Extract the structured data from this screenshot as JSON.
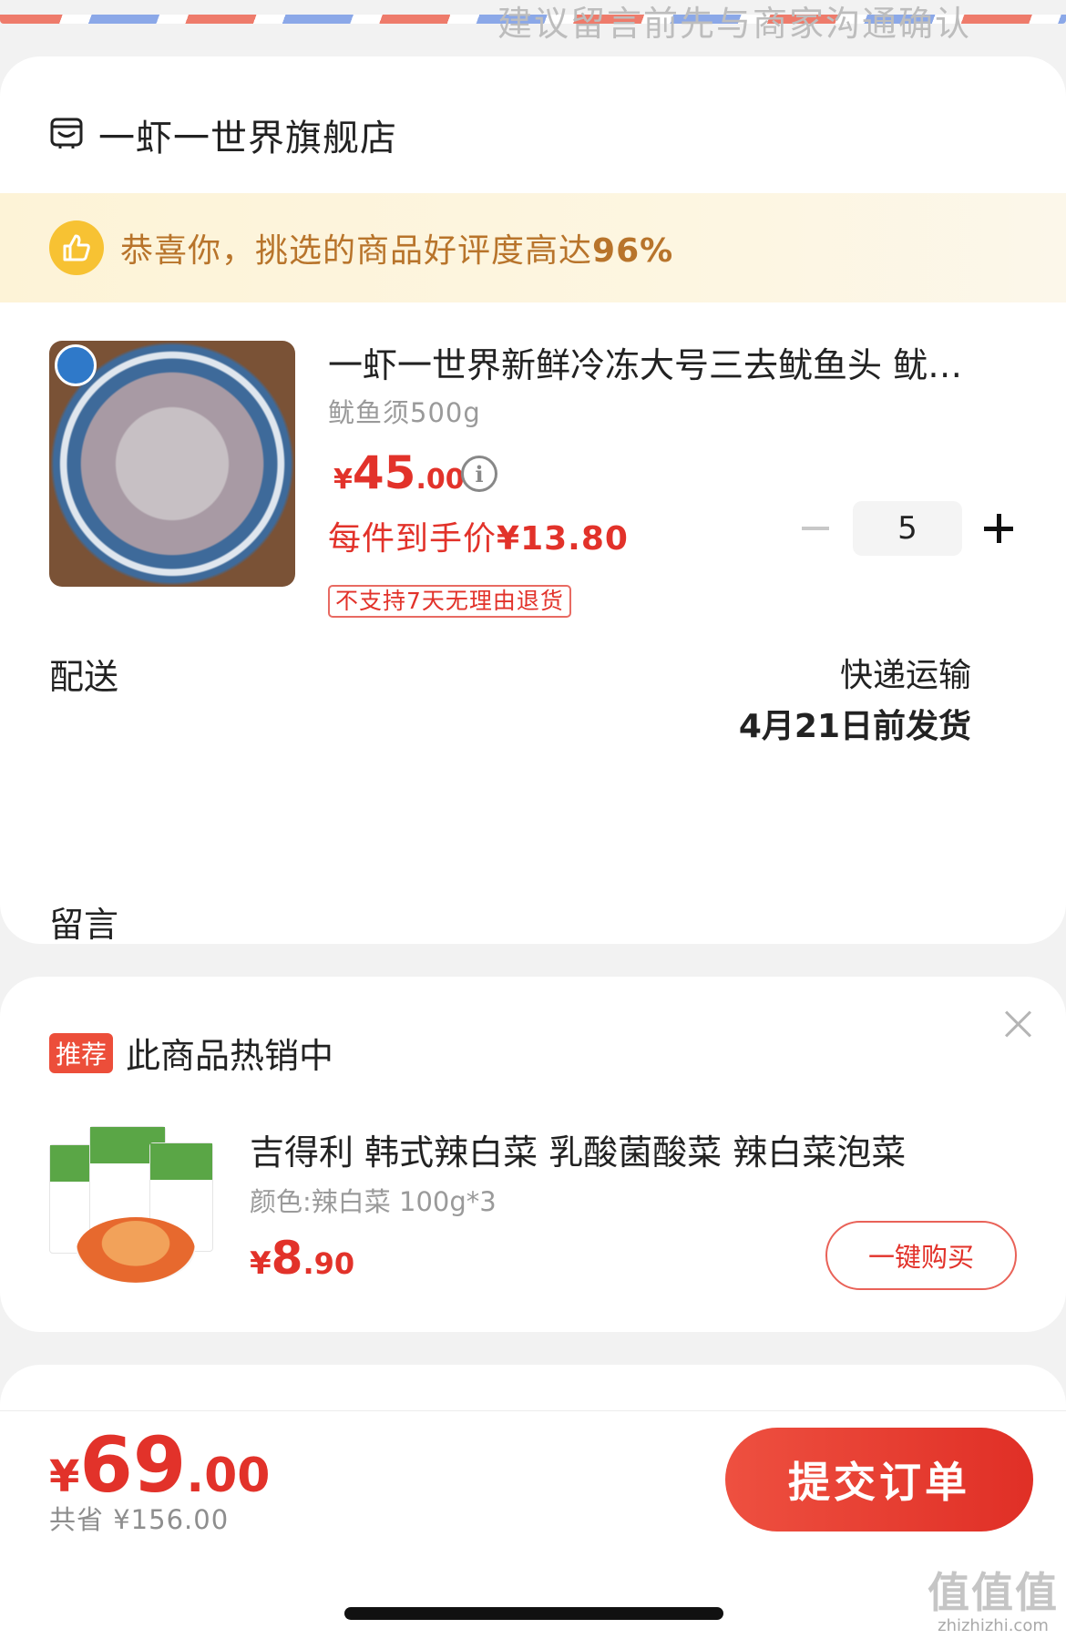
{
  "store": {
    "name": "一虾一世界旗舰店",
    "icon": "store-icon"
  },
  "praise": {
    "text": "恭喜你，挑选的商品好评度高达",
    "rate": "96%",
    "icon": "thumbs-up-icon"
  },
  "product": {
    "title": "一虾一世界新鲜冷冻大号三去鱿鱼头 鱿鱼须",
    "spec": "鱿鱼须500g",
    "price_symbol": "¥",
    "price_int": "45",
    "price_dec": ".00",
    "quantity": "5",
    "unit_price_label": "每件到手价",
    "unit_price": "¥13.80",
    "return_policy": "不支持7天无理由退货"
  },
  "delivery": {
    "label": "配送",
    "method": "快递运输",
    "ship_date": "4月21日前发货"
  },
  "memo": {
    "label": "留言",
    "placeholder": "建议留言前先与商家沟通确认"
  },
  "recommend": {
    "tag": "推荐",
    "title": "此商品热销中",
    "item_name": "吉得利 韩式辣白菜  乳酸菌酸菜 辣白菜泡菜",
    "item_spec": "颜色:辣白菜 100g*3",
    "price_symbol": "¥",
    "price_int": "8",
    "price_dec": ".90",
    "buy_label": "一键购买"
  },
  "footer": {
    "total_symbol": "¥",
    "total_int": "69",
    "total_dec": ".00",
    "saved": "共省 ¥156.00",
    "submit_label": "提交订单"
  },
  "watermark": {
    "big": "值值值",
    "small": "zhizhizhi.com"
  },
  "colors": {
    "accent": "#e2322a",
    "praise_text": "#b8742b",
    "praise_bg": "#fdf3d7",
    "tag_bg": "#ec4e3a"
  }
}
